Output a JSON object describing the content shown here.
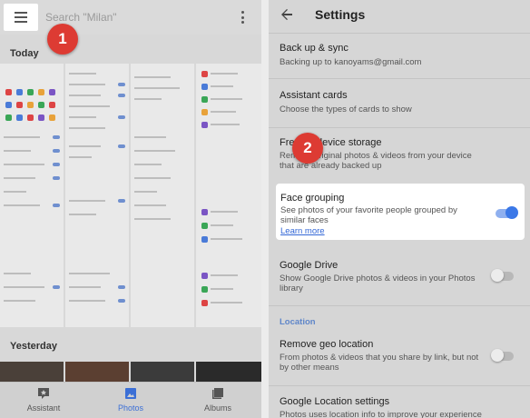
{
  "colors": {
    "accent_blue": "#3367d6",
    "badge_red": "#dd3b33",
    "toggle_on": "#3b78e7",
    "toggle_off": "#9e9e9e"
  },
  "photos_app": {
    "search_placeholder": "Search \"Milan\"",
    "menu_icon": "hamburger-menu-icon",
    "overflow_icon": "more-vert-icon",
    "section_today": "Today",
    "section_yesterday": "Yesterday",
    "bottom_nav": [
      {
        "label": "Assistant",
        "icon": "assistant-icon",
        "active": false
      },
      {
        "label": "Photos",
        "icon": "photos-icon",
        "active": true
      },
      {
        "label": "Albums",
        "icon": "albums-icon",
        "active": false
      }
    ]
  },
  "step_badges": [
    "1",
    "2"
  ],
  "settings": {
    "title": "Settings",
    "back_icon": "back-arrow-icon",
    "items": [
      {
        "title": "Back up & sync",
        "subtitle": "Backing up to kanoyams@gmail.com"
      },
      {
        "title": "Assistant cards",
        "subtitle": "Choose the types of cards to show"
      },
      {
        "title": "Free up device storage",
        "subtitle": "Remove original photos & videos from your device that are already backed up"
      }
    ],
    "face_grouping": {
      "title": "Face grouping",
      "subtitle": "See photos of your favorite people grouped by similar faces",
      "link": "Learn more",
      "enabled": true
    },
    "google_drive": {
      "title": "Google Drive",
      "subtitle": "Show Google Drive photos & videos in your Photos library",
      "enabled": false
    },
    "location_section": "Location",
    "remove_geo": {
      "title": "Remove geo location",
      "subtitle": "From photos & videos that you share by link, but not by other means",
      "enabled": false
    },
    "location_settings": {
      "title": "Google Location settings",
      "subtitle": "Photos uses location info to improve your experience and"
    }
  }
}
